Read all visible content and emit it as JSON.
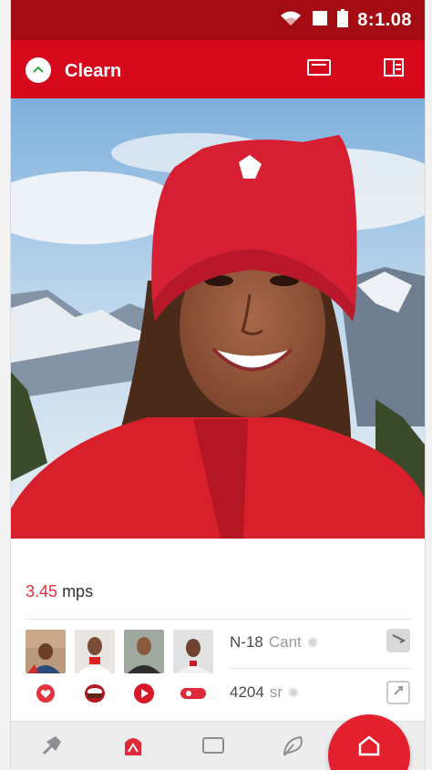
{
  "status_bar": {
    "time": "8:1.08",
    "icons": [
      "wifi-icon",
      "square-icon",
      "battery-icon"
    ]
  },
  "app_bar": {
    "title": "Clearn",
    "back_icon": "chevron-up-icon",
    "actions": [
      "screen-icon",
      "list-panel-icon"
    ]
  },
  "photo": {
    "subject": "selfie-photo"
  },
  "info": {
    "speed_value": "3.45",
    "speed_unit": "mps",
    "stats": [
      {
        "value": "N-18",
        "extra": "Cant"
      },
      {
        "value": "4204",
        "extra": "sr"
      }
    ],
    "thumb_actions": [
      "heart-icon",
      "cake-icon",
      "play-icon",
      "record-icon"
    ]
  },
  "bottom_nav": {
    "items": [
      "pin-icon",
      "alert-icon",
      "card-icon",
      "leaf-icon",
      "home-icon"
    ]
  },
  "colors": {
    "brand": "#d5091b",
    "status_bar": "#a30c12",
    "accent": "#e0313d"
  }
}
